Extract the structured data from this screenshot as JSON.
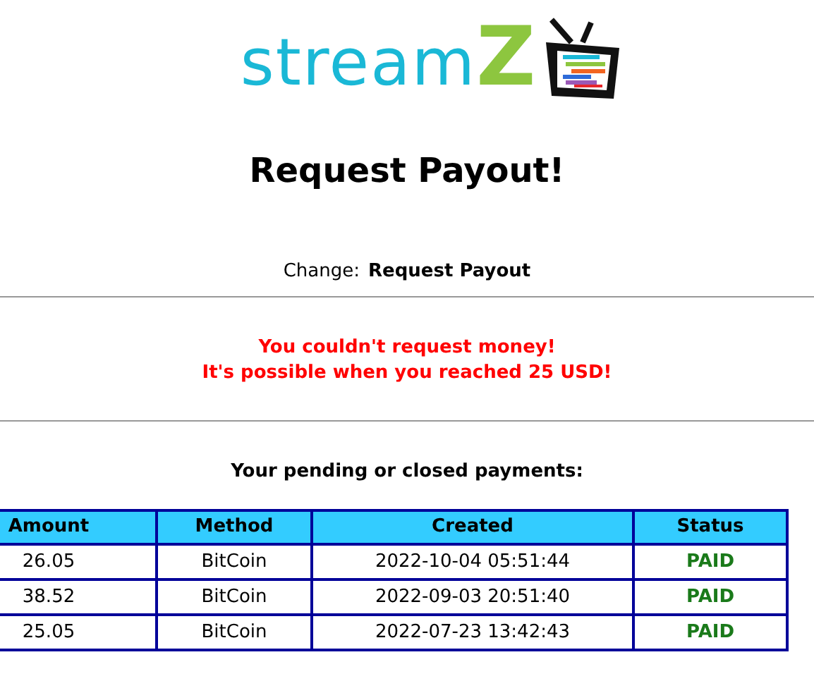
{
  "logo": {
    "text": "stream",
    "accent": "Z"
  },
  "title": "Request Payout!",
  "change": {
    "label": "Change:",
    "link": "Request Payout"
  },
  "error": [
    "You couldn't request money!",
    "It's possible when you reached 25 USD!"
  ],
  "payments_heading": "Your pending or closed payments:",
  "table": {
    "columns": [
      "Amount",
      "Method",
      "Created",
      "Status"
    ],
    "rows": [
      {
        "amount": "26.05",
        "method": "BitCoin",
        "created": "2022-10-04 05:51:44",
        "status": "PAID"
      },
      {
        "amount": "38.52",
        "method": "BitCoin",
        "created": "2022-09-03 20:51:40",
        "status": "PAID"
      },
      {
        "amount": "25.05",
        "method": "BitCoin",
        "created": "2022-07-23 13:42:43",
        "status": "PAID"
      }
    ]
  }
}
